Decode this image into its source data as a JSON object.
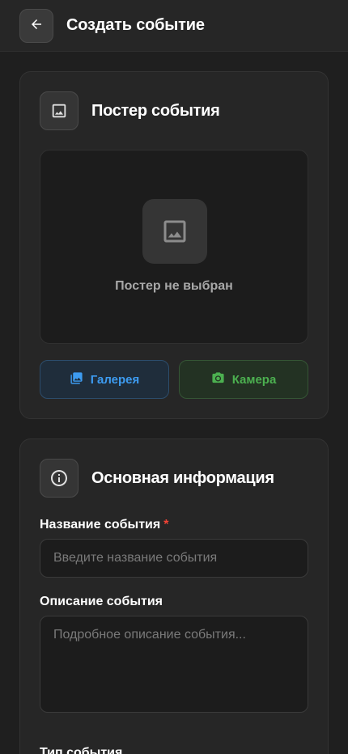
{
  "header": {
    "title": "Создать событие",
    "back_icon": "arrow-left-icon"
  },
  "poster_section": {
    "title": "Постер события",
    "icon": "image-icon",
    "placeholder_text": "Постер не выбран",
    "gallery_label": "Галерея",
    "camera_label": "Камера"
  },
  "info_section": {
    "title": "Основная информация",
    "icon": "info-icon",
    "name_label": "Название события",
    "required_mark": "*",
    "name_placeholder": "Введите название события",
    "description_label": "Описание события",
    "description_placeholder": "Подробное описание события...",
    "type_label": "Тип события"
  },
  "colors": {
    "background": "#1f1f1f",
    "card": "#262626",
    "accent_blue": "#3d9bf0",
    "accent_green": "#4cb050",
    "required_red": "#f44336"
  }
}
